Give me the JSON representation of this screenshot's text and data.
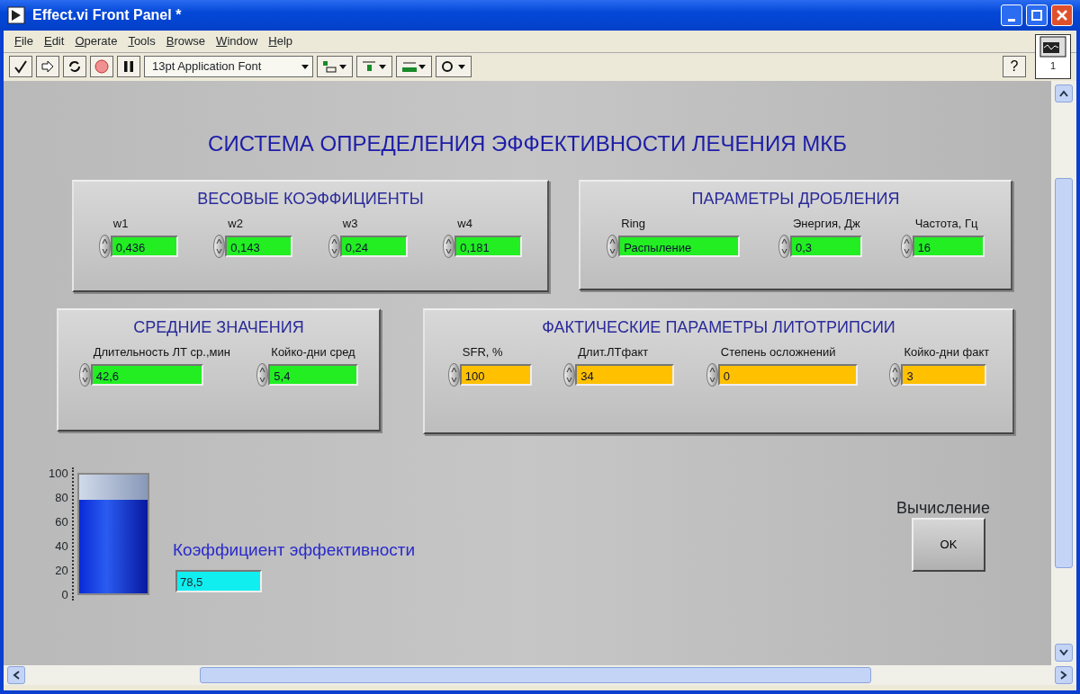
{
  "window": {
    "title": "Effect.vi Front Panel *"
  },
  "menu": [
    "File",
    "Edit",
    "Operate",
    "Tools",
    "Browse",
    "Window",
    "Help"
  ],
  "toolbar": {
    "font": "13pt Application Font",
    "help": "?",
    "vi_icon_number": "1"
  },
  "panel": {
    "title": "СИСТЕМА  ОПРЕДЕЛЕНИЯ  ЭФФЕКТИВНОСТИ  ЛЕЧЕНИЯ МКБ",
    "clusters": [
      {
        "title": "ВЕСОВЫЕ  КОЭФФИЦИЕНТЫ",
        "fields": [
          {
            "label": "w1",
            "value": "0,436",
            "color": "#22ee22"
          },
          {
            "label": "w2",
            "value": "0,143",
            "color": "#22ee22"
          },
          {
            "label": "w3",
            "value": "0,24",
            "color": "#22ee22"
          },
          {
            "label": "w4",
            "value": "0,181",
            "color": "#22ee22"
          }
        ]
      },
      {
        "title": "ПАРАМЕТРЫ  ДРОБЛЕНИЯ",
        "fields": [
          {
            "label": "Ring",
            "value": "Распыление",
            "color": "#22ee22"
          },
          {
            "label": "Энергия, Дж",
            "value": "0,3",
            "color": "#22ee22"
          },
          {
            "label": "Частота, Гц",
            "value": "16",
            "color": "#22ee22"
          }
        ]
      },
      {
        "title": "СРЕДНИЕ  ЗНАЧЕНИЯ",
        "fields": [
          {
            "label": "Длительность ЛТ ср.,мин",
            "value": "42,6",
            "color": "#22ee22"
          },
          {
            "label": "Койко-дни сред",
            "value": "5,4",
            "color": "#22ee22"
          }
        ]
      },
      {
        "title": "ФАКТИЧЕСКИЕ  ПАРАМЕТРЫ  ЛИТОТРИПСИИ",
        "fields": [
          {
            "label": "SFR, %",
            "value": "100",
            "color": "#ffc000"
          },
          {
            "label": "Длит.ЛТфакт",
            "value": "34",
            "color": "#ffc000"
          },
          {
            "label": "Степень осложнений",
            "value": "0",
            "color": "#ffc000"
          },
          {
            "label": "Койко-дни факт",
            "value": "3",
            "color": "#ffc000"
          }
        ]
      }
    ],
    "tank": {
      "level": 0.785,
      "scale": [
        "100",
        "80",
        "60",
        "40",
        "20",
        "0"
      ]
    },
    "result": {
      "label": "Коэффициент эффективности",
      "value": "78,5"
    },
    "button": {
      "label": "Вычисление",
      "text": "OK"
    }
  }
}
